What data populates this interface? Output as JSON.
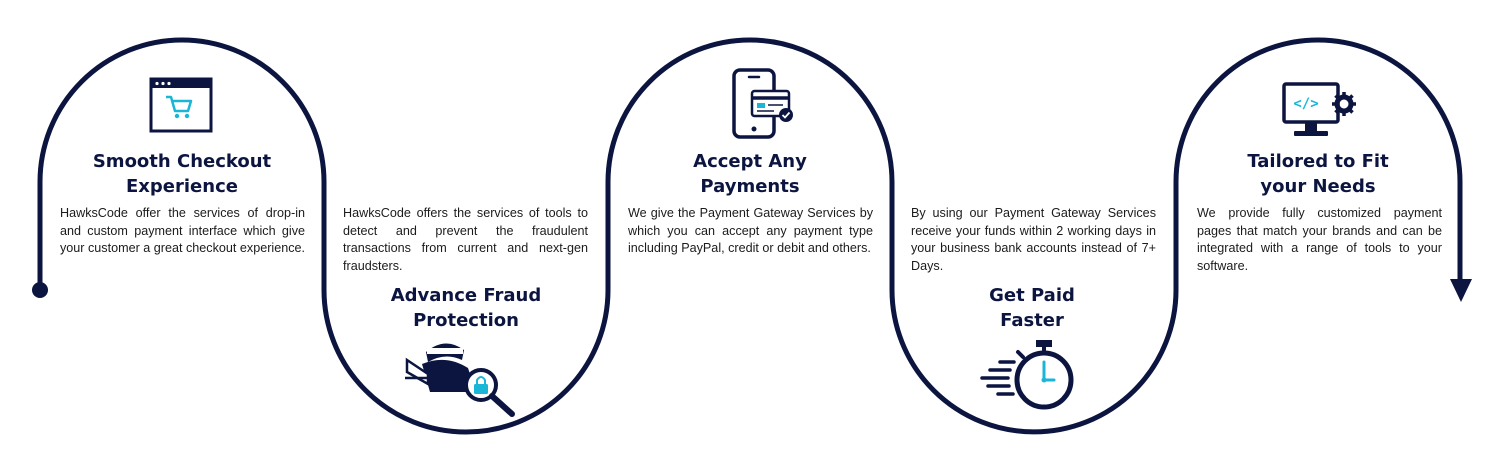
{
  "colors": {
    "navy": "#0c1540",
    "accent": "#1ab6d8",
    "text": "#1b1b1b",
    "background": "#ffffff"
  },
  "steps": [
    {
      "title": "Smooth Checkout Experience",
      "title_lines": [
        "Smooth Checkout",
        "Experience"
      ],
      "description": "HawksCode offer the services of drop-in and custom payment interface which give your customer a great checkout experience.",
      "icon": "browser-cart-icon"
    },
    {
      "title": "Advance Fraud Protection",
      "title_lines": [
        "Advance Fraud",
        "Protection"
      ],
      "description": "HawksCode offers the services of tools to detect and prevent the fraudulent transactions from current and next-gen fraudsters.",
      "icon": "hacker-magnifier-lock-icon"
    },
    {
      "title": "Accept Any Payments",
      "title_lines": [
        "Accept Any",
        "Payments"
      ],
      "description": "We give the Payment Gateway Services by which you can accept any payment type including PayPal, credit or debit and others.",
      "icon": "phone-credit-card-icon"
    },
    {
      "title": "Get Paid Faster",
      "title_lines": [
        "Get Paid",
        "Faster"
      ],
      "description": "By using our Payment Gateway Services receive your funds within 2 working days in your business bank accounts instead of 7+ Days.",
      "icon": "stopwatch-speed-icon"
    },
    {
      "title": "Tailored to Fit your Needs",
      "title_lines": [
        "Tailored to Fit",
        "your Needs"
      ],
      "description": "We provide fully customized payment pages that match your brands and can be integrated with a range of tools to your software.",
      "icon": "monitor-code-gear-icon"
    }
  ]
}
